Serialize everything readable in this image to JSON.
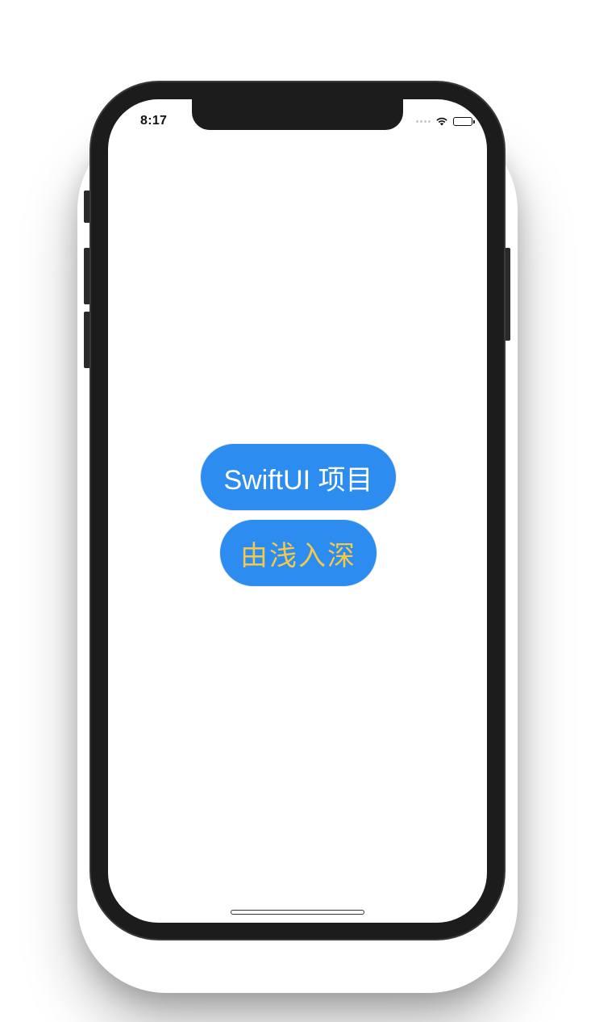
{
  "status_bar": {
    "time": "8:17",
    "icons": [
      "signal-dots-icon",
      "wifi-icon",
      "battery-icon"
    ]
  },
  "content": {
    "primary_text": "SwiftUI 项目",
    "secondary_text": "由浅入深"
  },
  "colors": {
    "pill_background": "#2d8cf0",
    "primary_text": "#ffffff",
    "secondary_text": "#f2c94c",
    "device_frame": "#1c1c1c"
  }
}
